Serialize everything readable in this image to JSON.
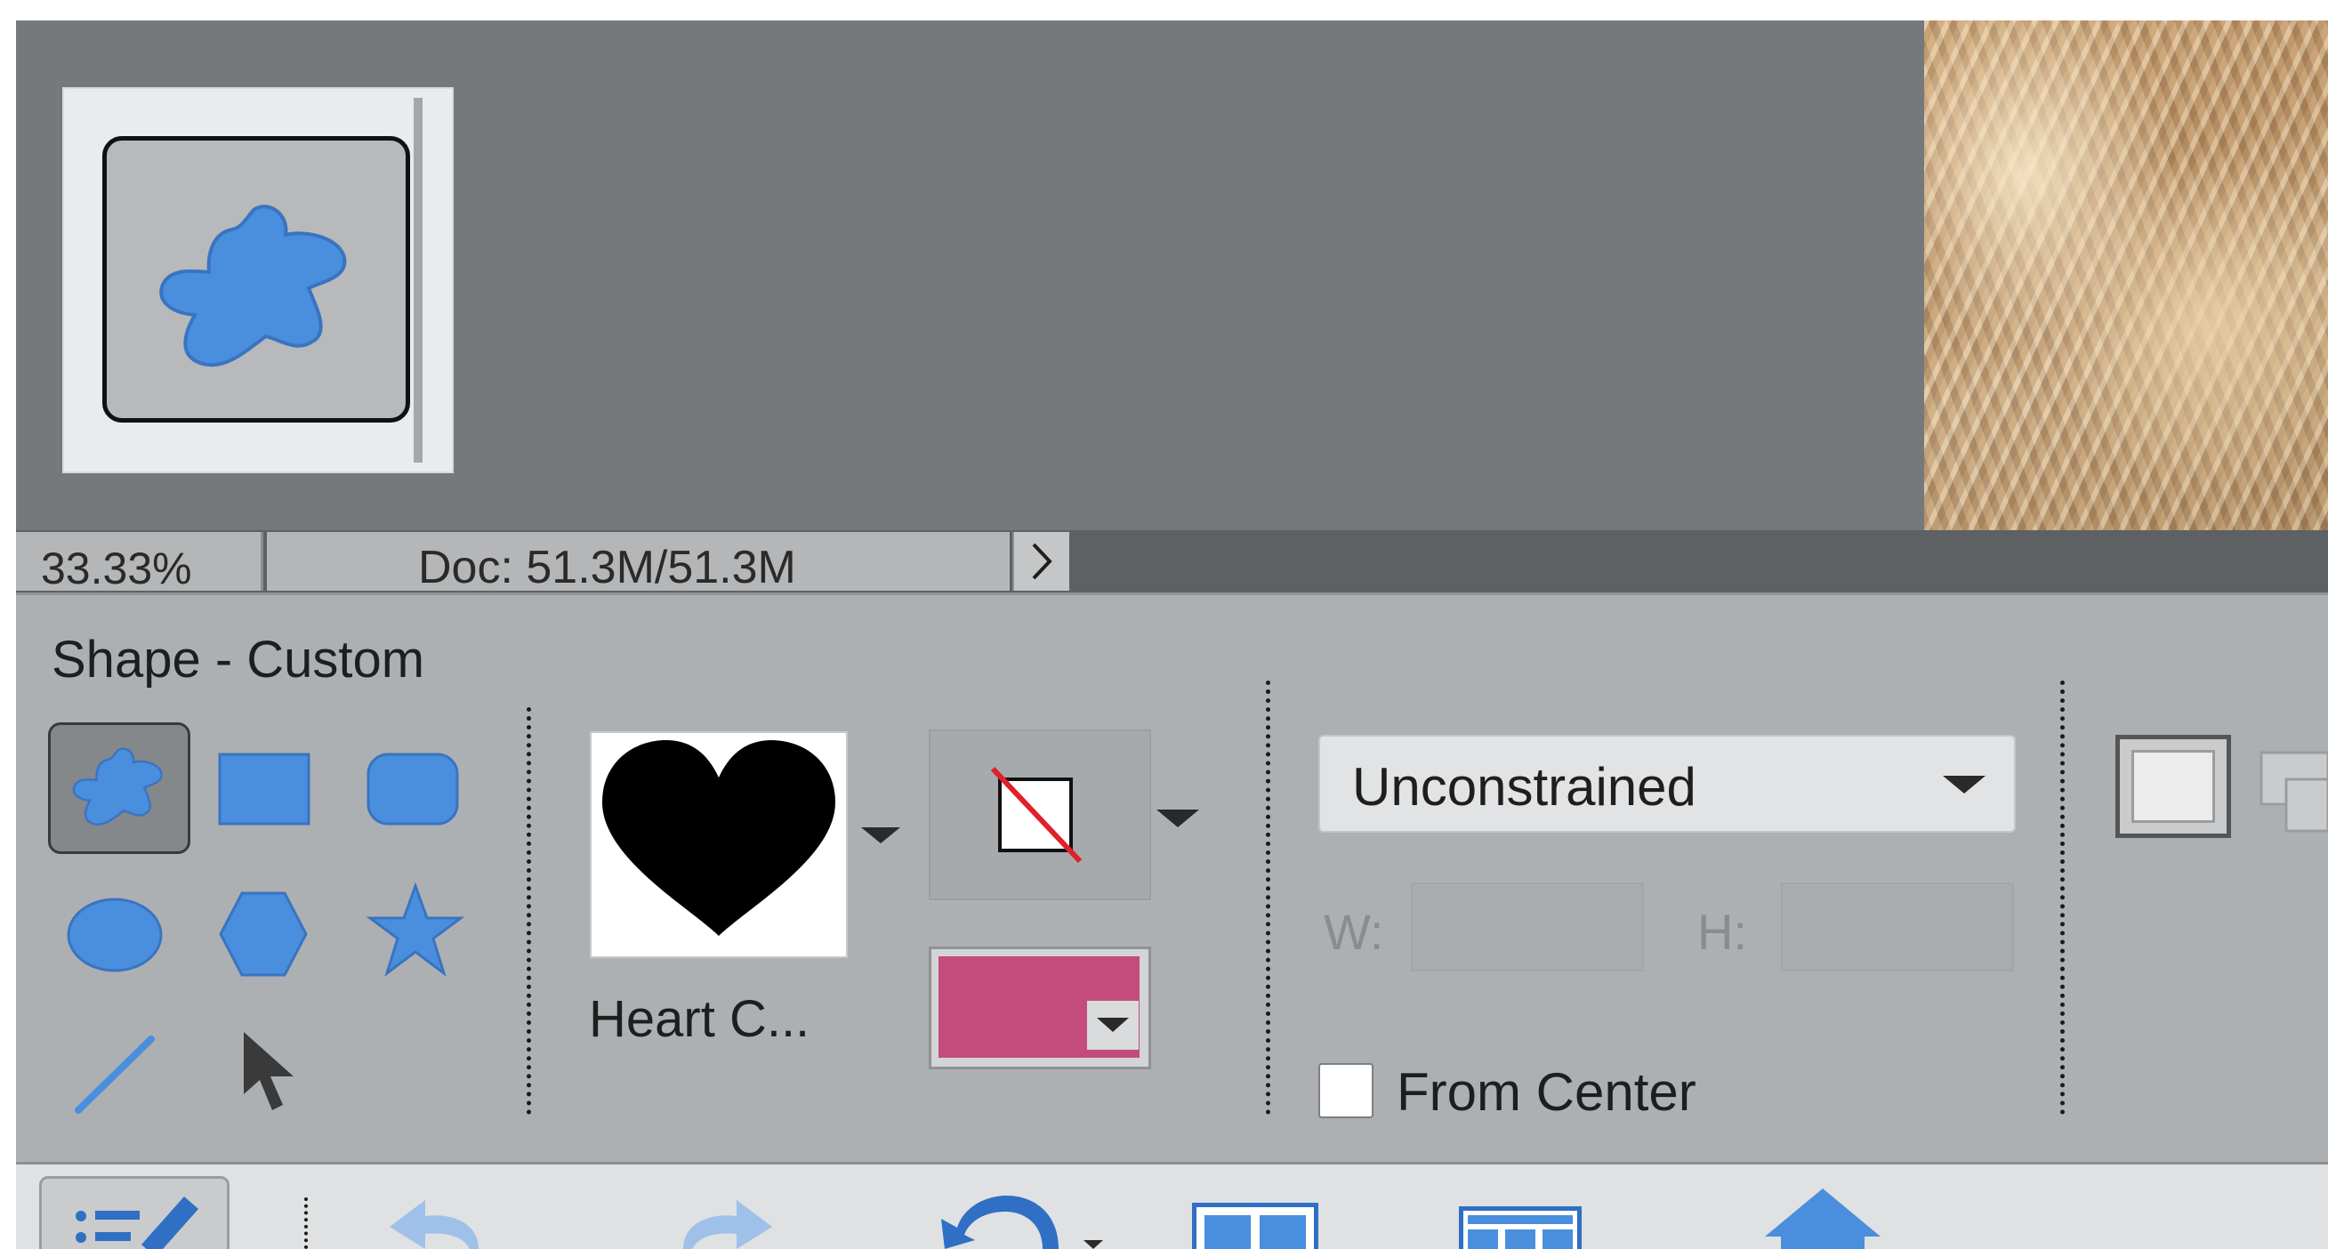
{
  "status_bar": {
    "zoom": "33.33%",
    "doc_info": "Doc: 51.3M/51.3M",
    "expand_icon": "chevron-right-icon"
  },
  "tool_options": {
    "title": "Shape - Custom",
    "shape_tools": [
      {
        "name": "custom-shape",
        "icon": "custom-shape-icon",
        "selected": true
      },
      {
        "name": "rectangle",
        "icon": "rectangle-icon"
      },
      {
        "name": "rounded-rectangle",
        "icon": "rounded-rectangle-icon"
      },
      {
        "name": "ellipse",
        "icon": "ellipse-icon"
      },
      {
        "name": "polygon",
        "icon": "polygon-icon"
      },
      {
        "name": "star",
        "icon": "star-icon"
      },
      {
        "name": "line",
        "icon": "line-icon"
      },
      {
        "name": "shape-selection",
        "icon": "arrow-pointer-icon"
      }
    ],
    "shape_picker": {
      "label": "Heart C...",
      "icon": "heart-icon"
    },
    "style_picker": {
      "icon": "no-style-icon"
    },
    "color": "#c44c7c",
    "constraint": {
      "value": "Unconstrained"
    },
    "width_label": "W:",
    "height_label": "H:",
    "width_value": "",
    "height_value": "",
    "from_center": {
      "label": "From Center",
      "checked": false
    }
  },
  "colors": {
    "accent_blue": "#4a8ede",
    "canvas_gray": "#76797b",
    "panel_gray": "#adb0b2"
  }
}
